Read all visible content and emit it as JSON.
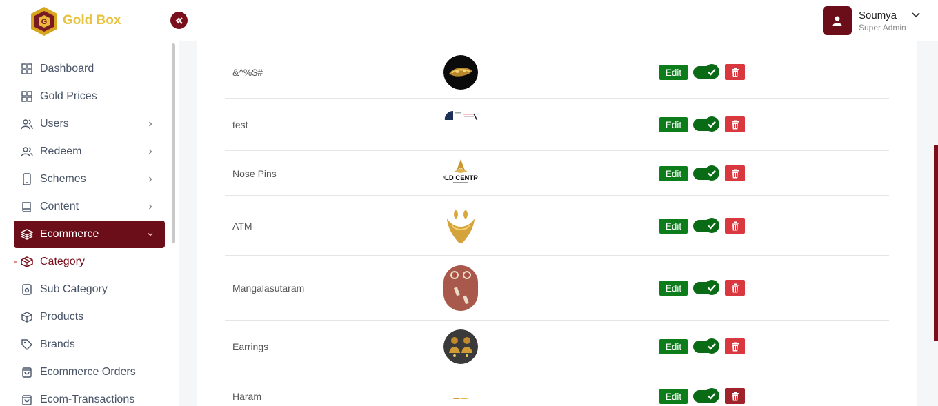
{
  "brand": {
    "name": "Gold Box",
    "accent": "#e8c33f",
    "primary": "#6b0e1a"
  },
  "sidebar": {
    "items": [
      {
        "label": "Dashboard",
        "icon": "grid-icon",
        "chevron": false
      },
      {
        "label": "Gold Prices",
        "icon": "grid-icon",
        "chevron": false
      },
      {
        "label": "Users",
        "icon": "users-icon",
        "chevron": true
      },
      {
        "label": "Redeem",
        "icon": "users-icon",
        "chevron": true
      },
      {
        "label": "Schemes",
        "icon": "phone-icon",
        "chevron": true
      },
      {
        "label": "Content",
        "icon": "book-icon",
        "chevron": true
      },
      {
        "label": "Ecommerce",
        "icon": "layers-icon",
        "chevron": true,
        "active": true
      },
      {
        "label": "Category",
        "icon": "cube-icon",
        "current": true
      },
      {
        "label": "Sub Category",
        "icon": "square-icon"
      },
      {
        "label": "Products",
        "icon": "box-icon"
      },
      {
        "label": "Brands",
        "icon": "tag-icon"
      },
      {
        "label": "Ecommerce Orders",
        "icon": "bag-icon"
      },
      {
        "label": "Ecom-Transactions",
        "icon": "bag-icon"
      }
    ]
  },
  "header": {
    "user_name": "Soumya",
    "user_role": "Super Admin"
  },
  "table": {
    "edit_label": "Edit",
    "rows": [
      {
        "name": "&^%$#",
        "image": "jewel-dark",
        "enabled": true
      },
      {
        "name": "test",
        "image": "doc-preview",
        "enabled": true
      },
      {
        "name": "Nose Pins",
        "image": "gold-central-logo",
        "enabled": true
      },
      {
        "name": "ATM",
        "image": "gold-necklace",
        "enabled": true
      },
      {
        "name": "Mangalasutaram",
        "image": "earring-pair",
        "enabled": true
      },
      {
        "name": "Earrings",
        "image": "jhumka",
        "enabled": true
      },
      {
        "name": "Haram",
        "image": "gold-chain",
        "enabled": true
      }
    ]
  },
  "colors": {
    "edit": "#0d7d1c",
    "toggle": "#0a6b17",
    "delete": "#d9383f"
  }
}
